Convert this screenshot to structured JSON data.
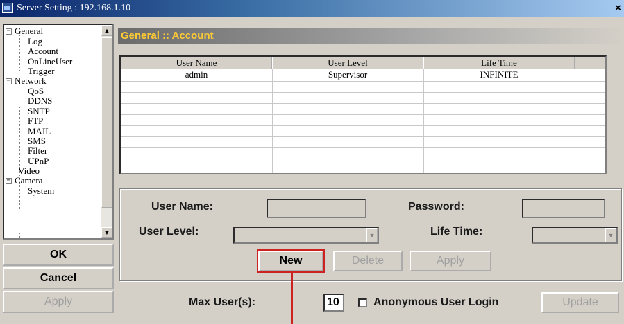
{
  "window": {
    "title": "Server Setting : 192.168.1.10",
    "close_glyph": "×"
  },
  "tree": {
    "items": [
      {
        "label": "General",
        "expander": "−"
      },
      {
        "label": "Log"
      },
      {
        "label": "Account"
      },
      {
        "label": "OnLineUser"
      },
      {
        "label": "Trigger"
      },
      {
        "label": "Network",
        "expander": "−"
      },
      {
        "label": "QoS"
      },
      {
        "label": "DDNS"
      },
      {
        "label": "SNTP"
      },
      {
        "label": "FTP"
      },
      {
        "label": "MAIL"
      },
      {
        "label": "SMS"
      },
      {
        "label": "Filter"
      },
      {
        "label": "UPnP"
      },
      {
        "label": "Video"
      },
      {
        "label": "Camera",
        "expander": "−"
      },
      {
        "label": "System"
      }
    ],
    "scroll_up": "▲",
    "scroll_down": "▼"
  },
  "side_buttons": {
    "ok": "OK",
    "cancel": "Cancel",
    "apply": "Apply"
  },
  "section": {
    "title": "General :: Account"
  },
  "table": {
    "columns": [
      "User Name",
      "User Level",
      "Life Time",
      ""
    ],
    "rows": [
      [
        "admin",
        "Supervisor",
        "INFINITE",
        ""
      ]
    ]
  },
  "form": {
    "user_name_label": "User Name:",
    "user_name_value": "",
    "password_label": "Password:",
    "password_value": "",
    "user_level_label": "User Level:",
    "user_level_value": "",
    "life_time_label": "Life Time:",
    "life_time_value": "",
    "dropdown_glyph": "▼",
    "new_label": "New",
    "delete_label": "Delete",
    "apply_label": "Apply"
  },
  "footer": {
    "max_users_label": "Max User(s):",
    "max_users_value": "10",
    "anonymous_label": "Anonymous User Login",
    "update_label": "Update"
  },
  "colors": {
    "title_accent": "#ffcc33",
    "highlight": "#cc2222"
  }
}
